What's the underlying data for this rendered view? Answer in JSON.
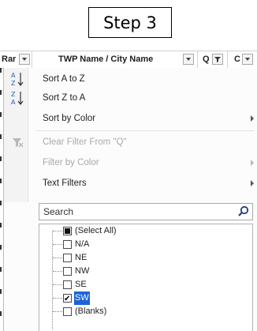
{
  "step_label": "Step 3",
  "header": {
    "col1": "Rar",
    "col2": "TWP Name / City Name",
    "col3": "Q",
    "col4": "C"
  },
  "menu": {
    "sort_az": "Sort A to Z",
    "sort_za": "Sort Z to A",
    "sort_color": "Sort by Color",
    "clear_filter": "Clear Filter From \"Q\"",
    "filter_color": "Filter by Color",
    "text_filters": "Text Filters"
  },
  "search": {
    "placeholder": "Search"
  },
  "list": [
    {
      "label": "(Select All)",
      "state": "partial"
    },
    {
      "label": "N/A",
      "state": "unchecked"
    },
    {
      "label": "NE",
      "state": "unchecked"
    },
    {
      "label": "NW",
      "state": "unchecked"
    },
    {
      "label": "SE",
      "state": "unchecked"
    },
    {
      "label": "SW",
      "state": "checked"
    },
    {
      "label": "(Blanks)",
      "state": "unchecked"
    }
  ],
  "colors": {
    "selection": "#1c64d6",
    "disabled_text": "#a9a9a9"
  }
}
